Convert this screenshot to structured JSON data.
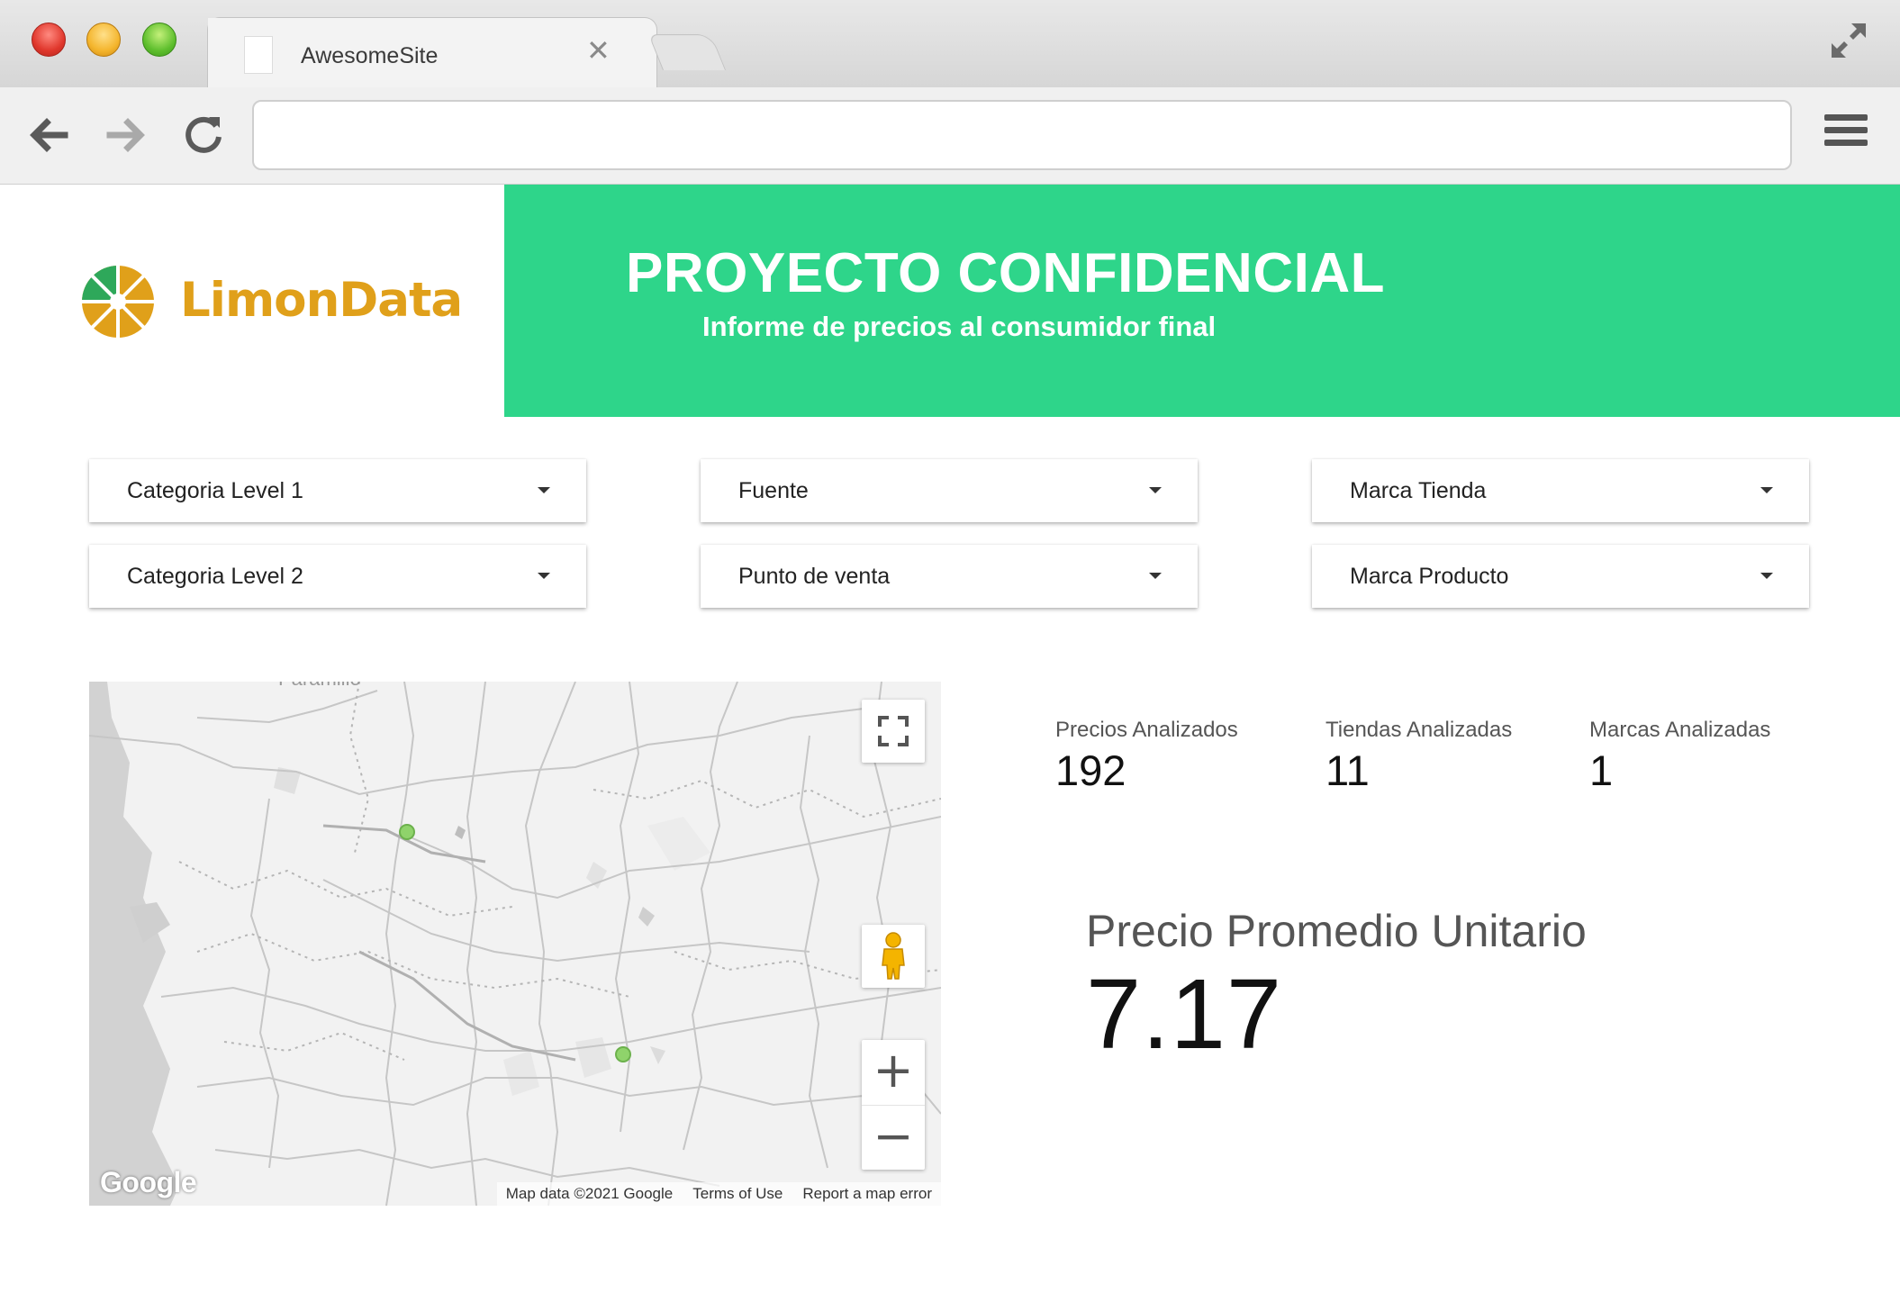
{
  "browser": {
    "tab_title": "AwesomeSite",
    "url": "",
    "icons": {
      "close": "close-icon",
      "back": "arrow-back-icon",
      "forward": "arrow-forward-icon",
      "reload": "reload-icon",
      "menu": "hamburger-menu-icon",
      "fullscreen": "expand-icon"
    }
  },
  "brand": {
    "logo_text": "LimonData",
    "logo_color": "#e0a01a",
    "logo_green": "#2ea85a"
  },
  "banner": {
    "title": "PROYECTO CONFIDENCIAL",
    "subtitle": "Informe de precios al consumidor final",
    "color": "#2ed58a"
  },
  "filters": [
    {
      "label": "Categoria Level 1"
    },
    {
      "label": "Fuente"
    },
    {
      "label": "Marca Tienda"
    },
    {
      "label": "Categoria Level 2"
    },
    {
      "label": "Punto de venta"
    },
    {
      "label": "Marca Producto"
    }
  ],
  "map": {
    "place_label": "Paramillo",
    "google_label": "Google",
    "footer": {
      "data": "Map data ©2021 Google",
      "terms": "Terms of Use",
      "report": "Report a map error"
    },
    "marker_color": "#8fd36b",
    "controls": {
      "fullscreen": "fullscreen-icon",
      "pegman": "pegman-icon",
      "zoom_in": "+",
      "zoom_out": "−"
    }
  },
  "kpis": [
    {
      "label": "Precios Analizados",
      "value": "192"
    },
    {
      "label": "Tiendas Analizadas",
      "value": "11"
    },
    {
      "label": "Marcas Analizadas",
      "value": "1"
    }
  ],
  "main_kpi": {
    "label": "Precio Promedio Unitario",
    "value": "7.17"
  }
}
